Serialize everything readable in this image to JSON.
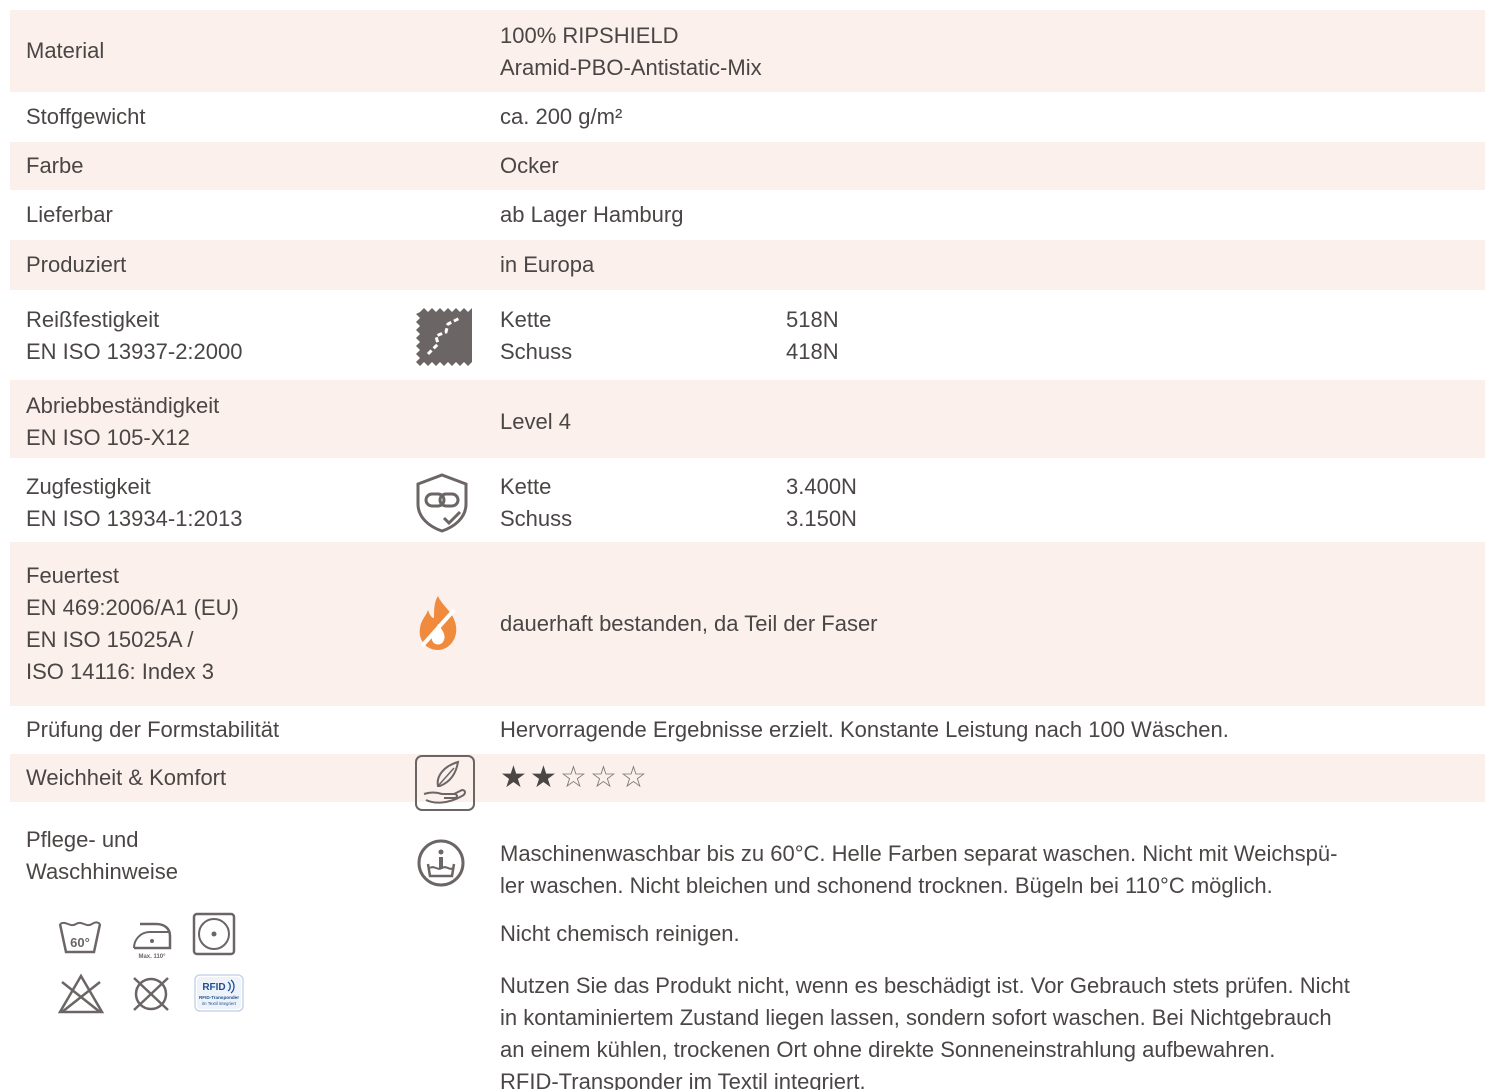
{
  "rows": {
    "material": {
      "label": "Material",
      "value1": "100% RIPSHIELD",
      "value2": "Aramid-PBO-Antistatic-Mix"
    },
    "weight": {
      "label": "Stoffgewicht",
      "value": "ca. 200 g/m²"
    },
    "color": {
      "label": "Farbe",
      "value": "Ocker"
    },
    "available": {
      "label": "Lieferbar",
      "value": "ab Lager Hamburg"
    },
    "produced": {
      "label": "Produziert",
      "value": "in Europa"
    },
    "tear": {
      "label1": "Reißfestigkeit",
      "label2": "EN ISO 13937-2:2000",
      "warp_label": "Kette",
      "warp_value": "518N",
      "weft_label": "Schuss",
      "weft_value": "418N"
    },
    "abrasion": {
      "label1": "Abriebbeständigkeit",
      "label2": "EN ISO 105-X12",
      "value": "Level 4"
    },
    "tensile": {
      "label1": "Zugfestigkeit",
      "label2": "EN ISO 13934-1:2013",
      "warp_label": "Kette",
      "warp_value": "3.400N",
      "weft_label": "Schuss",
      "weft_value": "3.150N"
    },
    "fire": {
      "label1": "Feuertest",
      "label2": "EN 469:2006/A1 (EU)",
      "label3": "EN ISO 15025A /",
      "label4": "ISO 14116: Index 3",
      "value": "dauerhaft bestanden, da Teil der Faser"
    },
    "stability": {
      "label": "Prüfung der Formstabilität",
      "value": "Hervorragende Ergebnisse erzielt. Konstante Leistung nach 100 Wäschen."
    },
    "comfort": {
      "label": "Weichheit & Komfort",
      "rating": 2,
      "max": 5
    },
    "care": {
      "label1": "Pflege- und",
      "label2": "Waschhinweise",
      "para1_line1": "Maschinenwaschbar bis zu 60°C. Helle Farben separat waschen. Nicht mit Weichspü-",
      "para1_line2": "ler waschen. Nicht bleichen und schonend trocknen. Bügeln bei 110°C möglich.",
      "para2": "Nicht chemisch reinigen.",
      "para3_line1": "Nutzen Sie das Produkt nicht, wenn es beschädigt ist. Vor Gebrauch stets prüfen. Nicht",
      "para3_line2": "in kontaminiertem Zustand liegen lassen, sondern sofort waschen. Bei Nichtgebrauch",
      "para3_line3": "an einem kühlen, trockenen Ort ohne direkte Sonneneinstrahlung aufbewahren.",
      "para3_line4": "RFID-Transponder im Textil integriert.",
      "wash_temp": "60°",
      "iron_max": "Max. 110°",
      "rfid_title": "RFID",
      "rfid_sub1": "RFID-Transponder",
      "rfid_sub2": "im Textil integriert"
    }
  },
  "colors": {
    "row_alt": "#fbf0ec",
    "text": "#4a4645",
    "icon": "#6b6665",
    "fire": "#f08a3c"
  },
  "icons": [
    "fabric-tear-icon",
    "shield-chain-icon",
    "flame-icon",
    "feather-hand-icon",
    "info-wash-icon",
    "wash-60-icon",
    "iron-110-icon",
    "tumble-dry-icon",
    "no-bleach-icon",
    "no-dry-clean-icon",
    "rfid-icon"
  ]
}
